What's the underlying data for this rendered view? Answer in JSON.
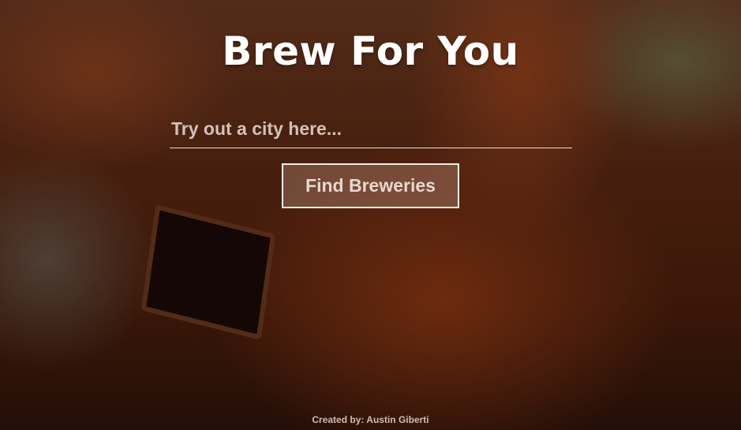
{
  "header": {
    "title": "Brew For You"
  },
  "search": {
    "placeholder": "Try out a city here...",
    "value": ""
  },
  "actions": {
    "find_label": "Find Breweries"
  },
  "footer": {
    "credit": "Created by: Austin Giberti"
  },
  "colors": {
    "text": "#ffffff",
    "button_border": "#f2ebe8"
  }
}
